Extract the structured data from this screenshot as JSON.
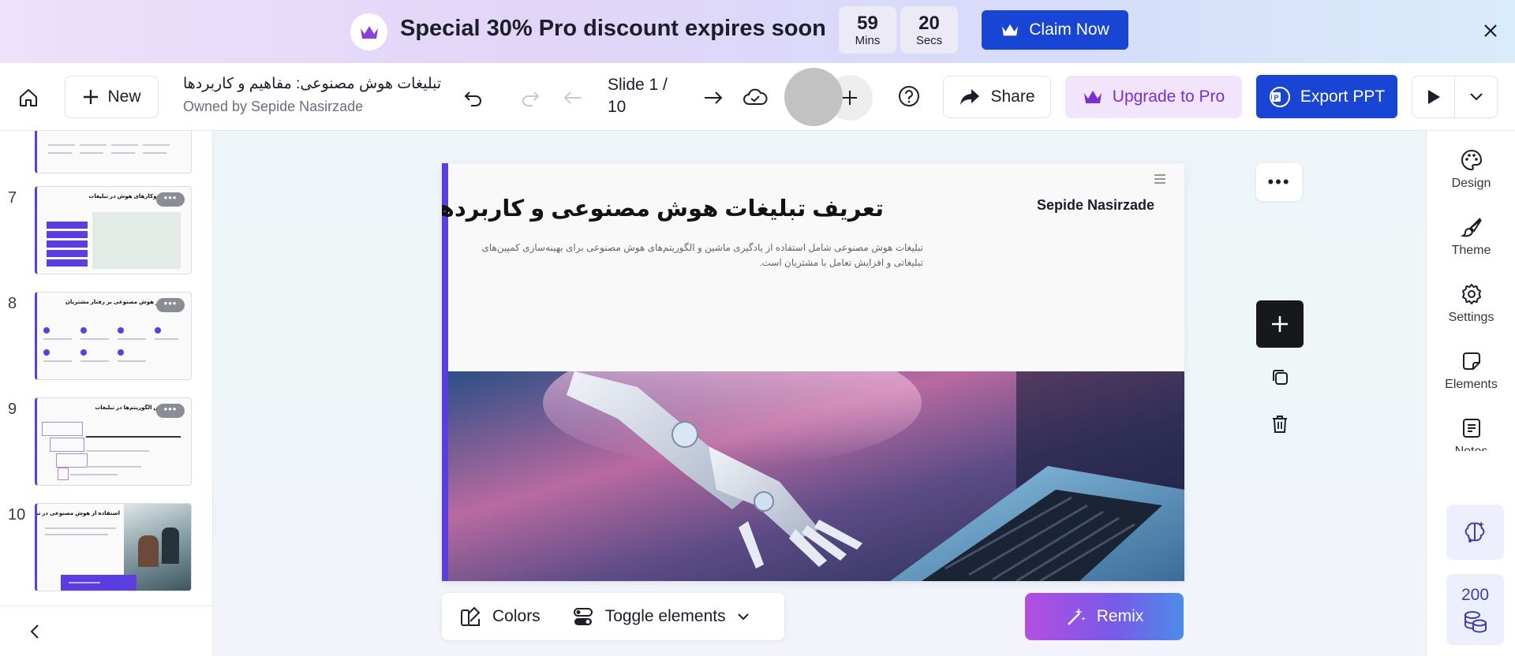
{
  "promo": {
    "text": "Special 30% Pro discount expires soon",
    "minutes": "59",
    "minutes_label": "Mins",
    "seconds": "20",
    "seconds_label": "Secs",
    "claim_label": "Claim Now"
  },
  "toolbar": {
    "new_label": "New",
    "doc_title": "تبلیغات هوش مصنوعی: مفاهیم و کاربردها",
    "doc_owner": "Owned by Sepide Nasirzade",
    "slide_counter_line1": "Slide 1 /",
    "slide_counter_line2": "10",
    "share_label": "Share",
    "upgrade_label": "Upgrade to Pro",
    "export_label": "Export PPT"
  },
  "thumbnails": [
    {
      "number": "7",
      "title": "ساز‌وکارهای هوش در تبلیغات",
      "more": "•••"
    },
    {
      "number": "8",
      "title": "تاثیر هوش مصنوعی بر رفتار مشتریان",
      "more": "•••"
    },
    {
      "number": "9",
      "title": "نقش الگوریتم‌ها در تبلیغات",
      "more": "•••"
    },
    {
      "number": "10",
      "title": "استفاده از هوش مصنوعی در تبلیغات",
      "more": "•••"
    }
  ],
  "slide": {
    "title": "تعریف تبلیغات هوش مصنوعی و کاربردهای آن",
    "author": "Sepide Nasirzade",
    "body": "تبلیغات هوش مصنوعی شامل استفاده از یادگیری ماشین و الگوریتم‌های هوش مصنوعی برای بهینه‌سازی کمپین‌های تبلیغاتی و افزایش تعامل با مشتریان است."
  },
  "bottom": {
    "colors_label": "Colors",
    "toggle_label": "Toggle elements",
    "remix_label": "Remix"
  },
  "right_panel": {
    "design": "Design",
    "theme": "Theme",
    "settings": "Settings",
    "elements": "Elements",
    "notes": "Notes",
    "credits": "200"
  },
  "colors": {
    "accent_blue": "#1945d4",
    "slide_accent_purple": "#5b3ee0",
    "upgrade_bg": "#f2e4fb"
  }
}
